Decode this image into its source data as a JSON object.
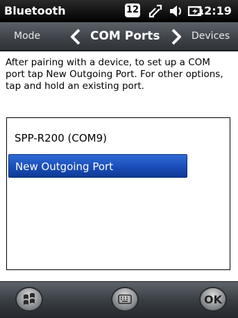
{
  "status_bar": {
    "title": "Bluetooth",
    "badge": "12",
    "time": "12:19",
    "icons": [
      "notification-badge-icon",
      "connectivity-icon",
      "volume-icon",
      "battery-charging-icon"
    ]
  },
  "nav": {
    "prev_tab": "Mode",
    "current_tab": "COM Ports",
    "next_tab": "Devices"
  },
  "main": {
    "instructions": "After pairing with a device, to set up a COM port tap New Outgoing Port. For other options, tap and hold an existing port.",
    "ports": [
      {
        "label": "SPP-R200 (COM9)",
        "selected": false
      },
      {
        "label": "New Outgoing Port",
        "selected": true
      }
    ]
  },
  "bottom_bar": {
    "ok_label": "OK",
    "icons": [
      "windows-start-icon",
      "keyboard-icon",
      "ok-icon"
    ]
  },
  "colors": {
    "selection": "#1a4db8",
    "bar_dark": "#000000"
  }
}
